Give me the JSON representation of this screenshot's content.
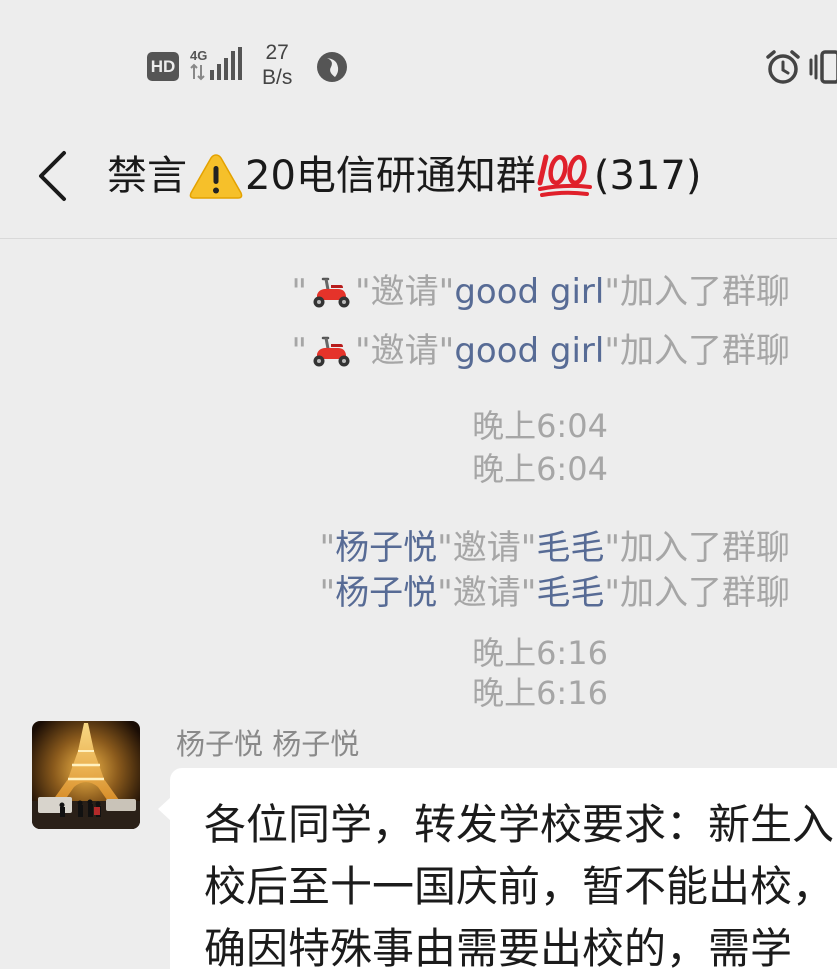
{
  "status_bar": {
    "hd_label": "HD",
    "network_label": "4G",
    "speed_value": "27",
    "speed_unit": "B/s",
    "icons": [
      "hd-icon",
      "signal-4g-icon",
      "compass-icon",
      "alarm-icon",
      "vibrate-icon"
    ]
  },
  "header": {
    "back_icon": "chevron-left-icon",
    "title_prefix": "禁言",
    "title_emoji_1": "warning-emoji",
    "title_middle": "20电信研通知群",
    "title_emoji_2": "hundred-points-emoji",
    "title_count": "(317)"
  },
  "messages": {
    "invite_1": {
      "q1": "\"",
      "inviter_emoji": "motor-scooter-emoji",
      "q2": "\"邀请\"",
      "invitee": "good girl",
      "suffix": "\"加入了群聊"
    },
    "invite_2": {
      "q1": "\"",
      "inviter_emoji": "motor-scooter-emoji",
      "q2": "\"邀请\"",
      "invitee": "good girl",
      "suffix": "\"加入了群聊"
    },
    "time_1a": "晚上6:04",
    "time_1b": "晚上6:04",
    "invite_3": {
      "q1": "\"",
      "inviter": "杨子悦",
      "q2": "\"邀请\"",
      "invitee": "毛毛",
      "suffix": "\"加入了群聊"
    },
    "invite_4": {
      "q1": "\"",
      "inviter": "杨子悦",
      "q2": "\"邀请\"",
      "invitee": "毛毛",
      "suffix": "\"加入了群聊"
    },
    "time_2a": "晚上6:16",
    "time_2b": "晚上6:16",
    "chat_message": {
      "sender": "杨子悦 杨子悦",
      "avatar": "eiffel-tower-photo",
      "lines": [
        "各位同学，转发学校要求：新生入",
        "校后至十一国庆前，暂不能出校，",
        "确因特殊事由需要出校的，需学"
      ]
    }
  },
  "colors": {
    "background": "#ededed",
    "link_name": "#576b95",
    "system_text": "#a6a6a6",
    "bubble": "#ffffff"
  }
}
